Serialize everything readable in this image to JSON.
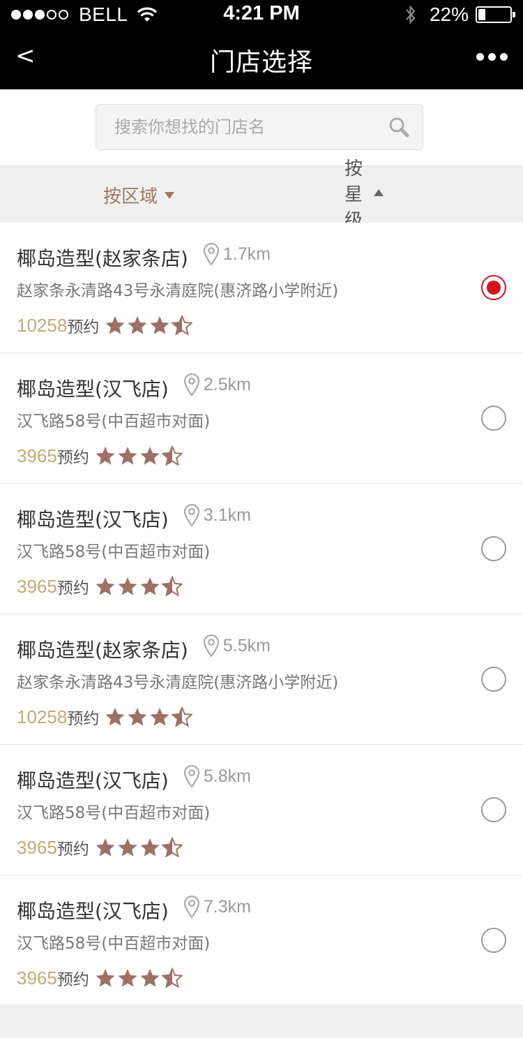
{
  "status_bar": {
    "carrier": "BELL",
    "time": "4:21 PM",
    "battery_percent": "22%",
    "battery_level": 0.22,
    "signal_strength": 3
  },
  "nav": {
    "back": "<",
    "title": "门店选择"
  },
  "search": {
    "placeholder": "搜索你想找的门店名",
    "value": ""
  },
  "filters": {
    "region": "按区域",
    "star": "按星级"
  },
  "colors": {
    "accent_brown": "#a07866",
    "star_color": "#9d7065",
    "count_gold": "#c5a975",
    "selected_red": "#d8101a"
  },
  "stores": [
    {
      "name": "椰岛造型(赵家条店)",
      "distance": "1.7km",
      "address": "赵家条永清路43号永清庭院(惠济路小学附近)",
      "count": "10258",
      "count_label": "预约",
      "rating": 3.5,
      "selected": true
    },
    {
      "name": "椰岛造型(汉飞店)",
      "distance": "2.5km",
      "address": "汉飞路58号(中百超市对面)",
      "count": "3965",
      "count_label": "预约",
      "rating": 3.5,
      "selected": false
    },
    {
      "name": "椰岛造型(汉飞店)",
      "distance": "3.1km",
      "address": "汉飞路58号(中百超市对面)",
      "count": "3965",
      "count_label": "预约",
      "rating": 3.5,
      "selected": false
    },
    {
      "name": "椰岛造型(赵家条店)",
      "distance": "5.5km",
      "address": "赵家条永清路43号永清庭院(惠济路小学附近)",
      "count": "10258",
      "count_label": "预约",
      "rating": 3.5,
      "selected": false
    },
    {
      "name": "椰岛造型(汉飞店)",
      "distance": "5.8km",
      "address": "汉飞路58号(中百超市对面)",
      "count": "3965",
      "count_label": "预约",
      "rating": 3.5,
      "selected": false
    },
    {
      "name": "椰岛造型(汉飞店)",
      "distance": "7.3km",
      "address": "汉飞路58号(中百超市对面)",
      "count": "3965",
      "count_label": "预约",
      "rating": 3.5,
      "selected": false
    }
  ]
}
